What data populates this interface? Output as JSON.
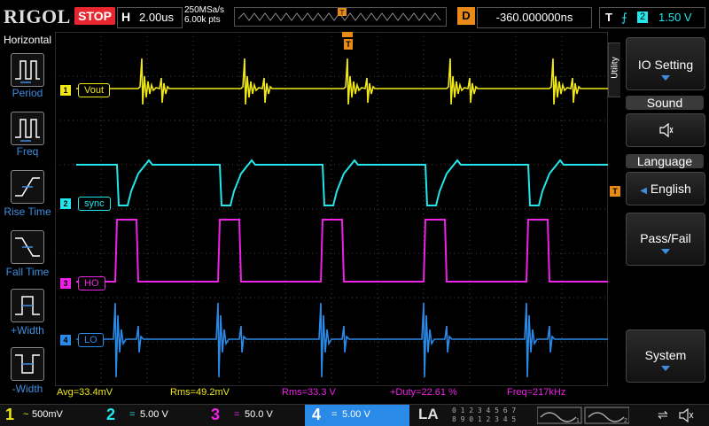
{
  "header": {
    "brand": "RIGOL",
    "run_status": "STOP",
    "timebase_label": "H",
    "timebase_value": "2.00us",
    "sample_rate": "250MSa/s",
    "memory_depth": "6.00k pts",
    "delay_label": "D",
    "delay_value": "-360.000000ns",
    "trigger_label": "T",
    "trigger_source": "2",
    "trigger_level": "1.50 V",
    "trigger_marker": "T"
  },
  "left_menu": {
    "title": "Horizontal",
    "items": [
      {
        "label": "Period",
        "icon": "period-icon"
      },
      {
        "label": "Freq",
        "icon": "freq-icon"
      },
      {
        "label": "Rise Time",
        "icon": "rise-time-icon"
      },
      {
        "label": "Fall Time",
        "icon": "fall-time-icon"
      },
      {
        "label": "+Width",
        "icon": "pos-width-icon"
      },
      {
        "label": "-Width",
        "icon": "neg-width-icon"
      }
    ]
  },
  "right_menu": {
    "tab": "Utility",
    "io_setting": "IO Setting",
    "sound_title": "Sound",
    "sound_icon": "speaker-icon",
    "language_title": "Language",
    "language_value": "English",
    "pass_fail": "Pass/Fail",
    "system": "System"
  },
  "channels": [
    {
      "id": "1",
      "label": "Vout",
      "color": "#f0e816",
      "scale": "500mV",
      "coupling": "~"
    },
    {
      "id": "2",
      "label": "sync",
      "color": "#22e6ec",
      "scale": "5.00 V",
      "coupling": "="
    },
    {
      "id": "3",
      "label": "HO",
      "color": "#ee22e6",
      "scale": "50.0 V",
      "coupling": "="
    },
    {
      "id": "4",
      "label": "LO",
      "color": "#2a8ae8",
      "scale": "5.00 V",
      "coupling": "="
    }
  ],
  "measurements": {
    "avg": "Avg=33.4mV",
    "rms1": "Rms=49.2mV",
    "rms3": "Rms=33.3 V",
    "duty": "+Duty=22.61 %",
    "freq": "Freq=217kHz"
  },
  "footer": {
    "la_label": "LA",
    "digital_row1": "0 1 2 3   4 5 6 7",
    "digital_row2": "8 9 0 1   2 3 4 5",
    "usb_icon": "usb-icon",
    "speaker_icon": "speaker-muted-icon"
  }
}
